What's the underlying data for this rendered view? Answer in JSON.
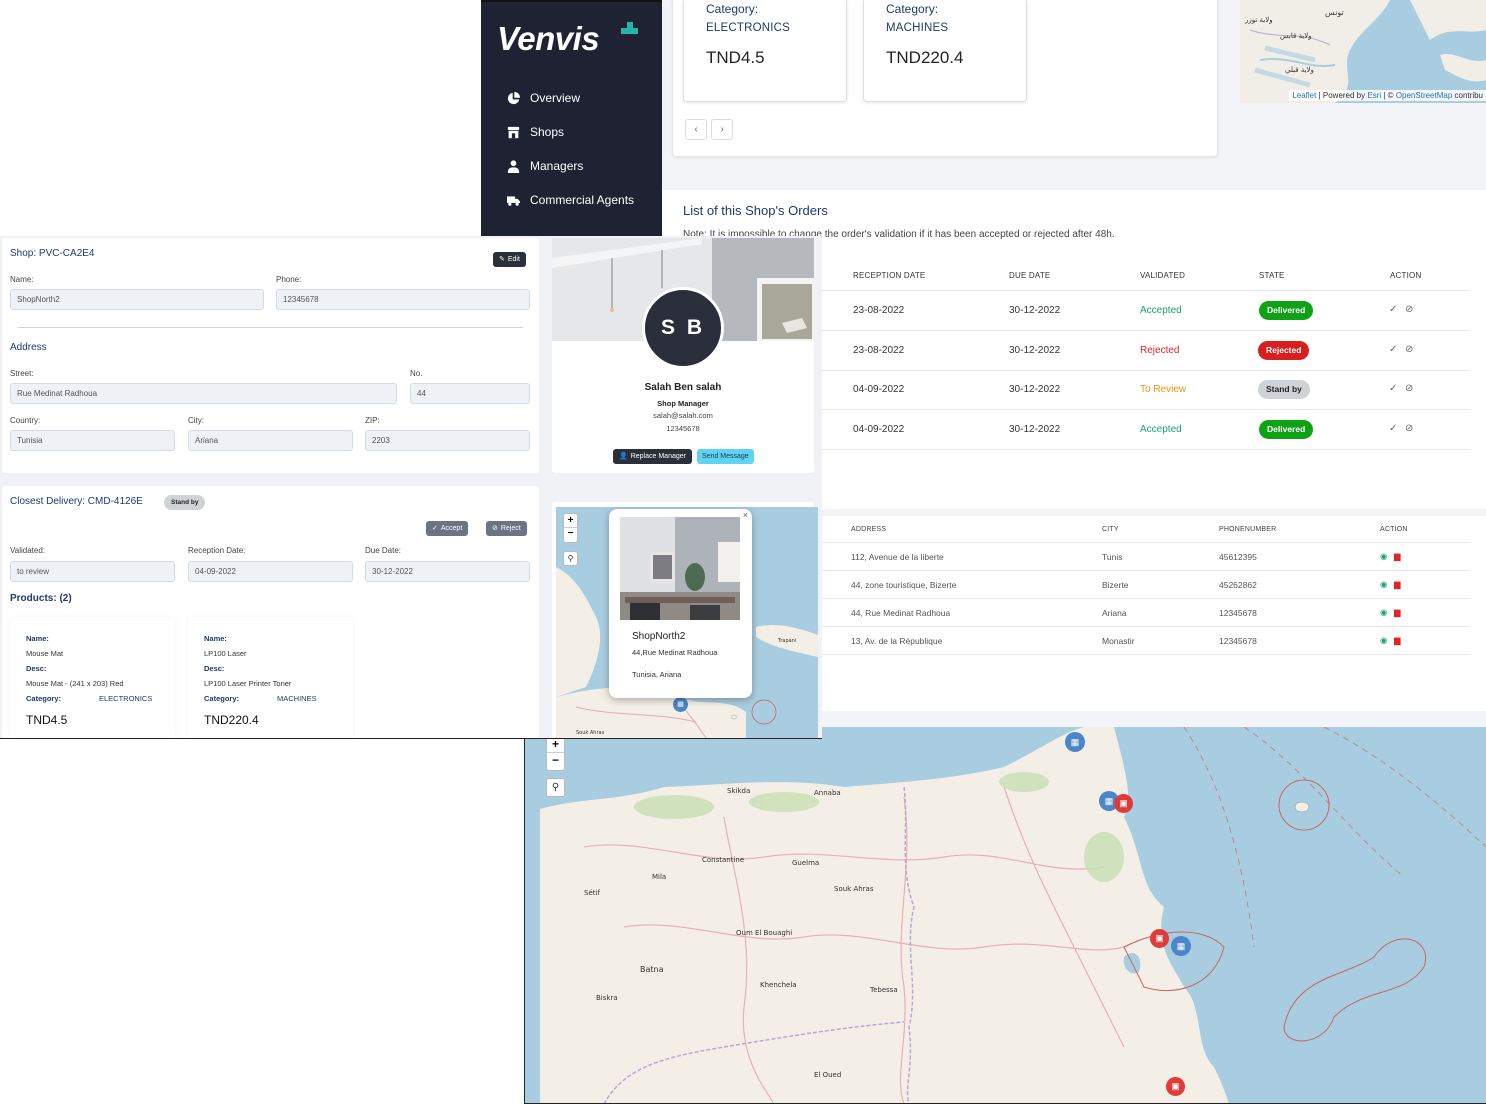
{
  "brand": {
    "name": "Venvis"
  },
  "sidebar": {
    "items": [
      {
        "label": "Overview",
        "icon": "pie-chart-icon"
      },
      {
        "label": "Shops",
        "icon": "store-icon"
      },
      {
        "label": "Managers",
        "icon": "user-tie-icon"
      },
      {
        "label": "Commercial Agents",
        "icon": "truck-icon"
      }
    ]
  },
  "top_products": [
    {
      "category_label": "Category:",
      "category": "ELECTRONICS",
      "price": "TND4.5"
    },
    {
      "category_label": "Category:",
      "category": "MACHINES",
      "price": "TND220.4"
    }
  ],
  "pager": {
    "prev": "‹",
    "next": "›"
  },
  "map_attribution": {
    "leaflet": "Leaflet",
    "powered": "| Powered by",
    "esri": "Esri",
    "sep": "| ©",
    "osm": "OpenStreetMap",
    "contrib": "contribu"
  },
  "orders": {
    "title": "List of this Shop's Orders",
    "note": "Note: It is impossible to change the order's validation if it has been accepted or rejected after 48h.",
    "columns": [
      "RECEPTION DATE",
      "DUE DATE",
      "VALIDATED",
      "STATE",
      "ACTION"
    ],
    "rows": [
      {
        "reception": "23-08-2022",
        "due": "30-12-2022",
        "validated": "Accepted",
        "state": "Delivered"
      },
      {
        "reception": "23-08-2022",
        "due": "30-12-2022",
        "validated": "Rejected",
        "state": "Rejected"
      },
      {
        "reception": "04-09-2022",
        "due": "30-12-2022",
        "validated": "To Review",
        "state": "Stand by"
      },
      {
        "reception": "04-09-2022",
        "due": "30-12-2022",
        "validated": "Accepted",
        "state": "Delivered"
      }
    ],
    "colors": {
      "accepted": "#1aa36b",
      "rejected": "#e02424",
      "review": "#f0930f",
      "delivered": "#0fa214",
      "rejected_pill": "#d81e1e",
      "standby": "#cfd2d6"
    }
  },
  "shops_table": {
    "columns": [
      "ADDRESS",
      "CITY",
      "PHONENUMBER",
      "ACTION"
    ],
    "rows": [
      {
        "address": "112, Avenue de la liberte",
        "city": "Tunis",
        "phone": "45612395"
      },
      {
        "address": "44, zone touristique, Bizerte",
        "city": "Bizerte",
        "phone": "45262862"
      },
      {
        "address": "44, Rue Medinat Radhoua",
        "city": "Ariana",
        "phone": "12345678"
      },
      {
        "address": "13, Av. de la République",
        "city": "Monastir",
        "phone": "12345678"
      }
    ]
  },
  "shop_form": {
    "title": "Shop: PVC-CA2E4",
    "edit_label": "Edit",
    "name_label": "Name:",
    "name": "ShopNorth2",
    "phone_label": "Phone:",
    "phone": "12345678",
    "address_title": "Address",
    "street_label": "Street:",
    "street": "Rue Medinat Radhoua",
    "no_label": "No.",
    "no": "44",
    "country_label": "Country:",
    "country": "Tunisia",
    "city_label": "City:",
    "city": "Ariana",
    "zip_label": "ZIP:",
    "zip": "2203"
  },
  "delivery": {
    "title": "Closest Delivery: CMD-4126E",
    "status": "Stand by",
    "accept_label": "Accept",
    "reject_label": "Reject",
    "validated_label": "Validated:",
    "validated": "to review",
    "reception_label": "Reception Date:",
    "reception": "04-09-2022",
    "due_label": "Due Date:",
    "due": "30-12-2022",
    "products_title": "Products: (2)",
    "products": [
      {
        "name_label": "Name:",
        "name": "Mouse Mat",
        "desc_label": "Desc:",
        "desc": "Mouse Mat - (241 x 203) Red",
        "cat_label": "Category:",
        "category": "ELECTRONICS",
        "price": "TND4.5"
      },
      {
        "name_label": "Name:",
        "name": "LP100 Laser",
        "desc_label": "Desc:",
        "desc": "LP100 Laser Printer Toner",
        "cat_label": "Category:",
        "category": "MACHINES",
        "price": "TND220.4"
      }
    ]
  },
  "manager": {
    "initials": "S B",
    "name": "Salah Ben salah",
    "role": "Shop Manager",
    "email": "salah@salah.com",
    "phone": "12345678",
    "replace_label": "Replace Manager",
    "message_label": "Send Message"
  },
  "popup": {
    "name": "ShopNorth2",
    "address": "44,Rue Medinat Radhoua",
    "location": "Tunisia, Ariana",
    "close": "×"
  },
  "map_labels": {
    "small": [
      "Trapani",
      "Souk Ahras"
    ],
    "big": [
      "Skikda",
      "Annaba",
      "Constantine",
      "Guelma",
      "Mila",
      "Souk Ahras",
      "Oum El Bouaghi",
      "Batna",
      "Khenchela",
      "Tebessa",
      "Biskra",
      "El Oued",
      "Sétif"
    ]
  },
  "zoom": {
    "in": "+",
    "out": "−"
  }
}
